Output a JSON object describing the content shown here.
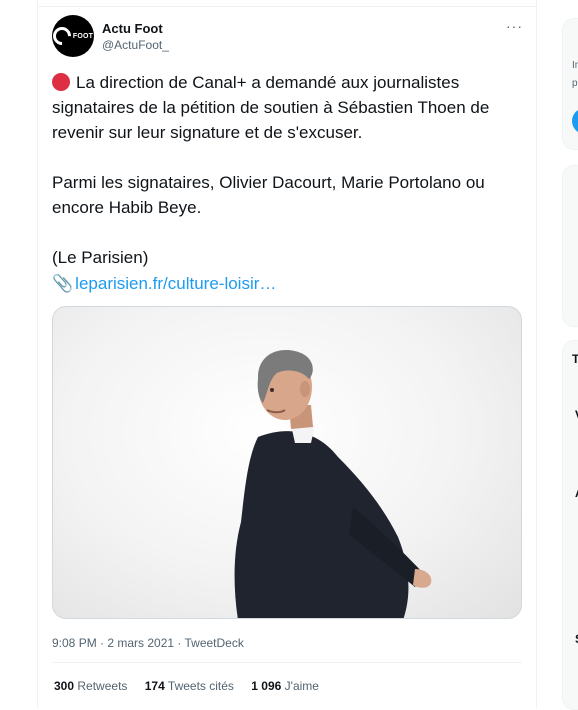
{
  "tweet": {
    "author_name": "Actu Foot",
    "author_handle": "@ActuFoot_",
    "avatar_text": "FOOT",
    "more_label": "···",
    "paragraph1": "La direction de Canal+ a demandé aux journalistes signataires de la pétition de soutien à Sébastien Thoen de revenir sur leur signature et de s'excuser.",
    "paragraph2": "Parmi les signataires, Olivier Dacourt, Marie Portolano ou encore Habib Beye.",
    "paragraph3": "(Le Parisien)",
    "link_icon": "📎",
    "link_text": "leparisien.fr/culture-loisir…",
    "timestamp": "9:08 PM · 2 mars 2021 · TweetDeck",
    "stats": [
      {
        "count": "300",
        "label": "Retweets"
      },
      {
        "count": "174",
        "label": "Tweets cités"
      },
      {
        "count": "1 096",
        "label": "J'aime"
      }
    ]
  },
  "sidebar_fragments": {
    "t1": "In",
    "t2": "p",
    "t3": "T",
    "t4": "V",
    "t5": "A",
    "t6": "S"
  }
}
